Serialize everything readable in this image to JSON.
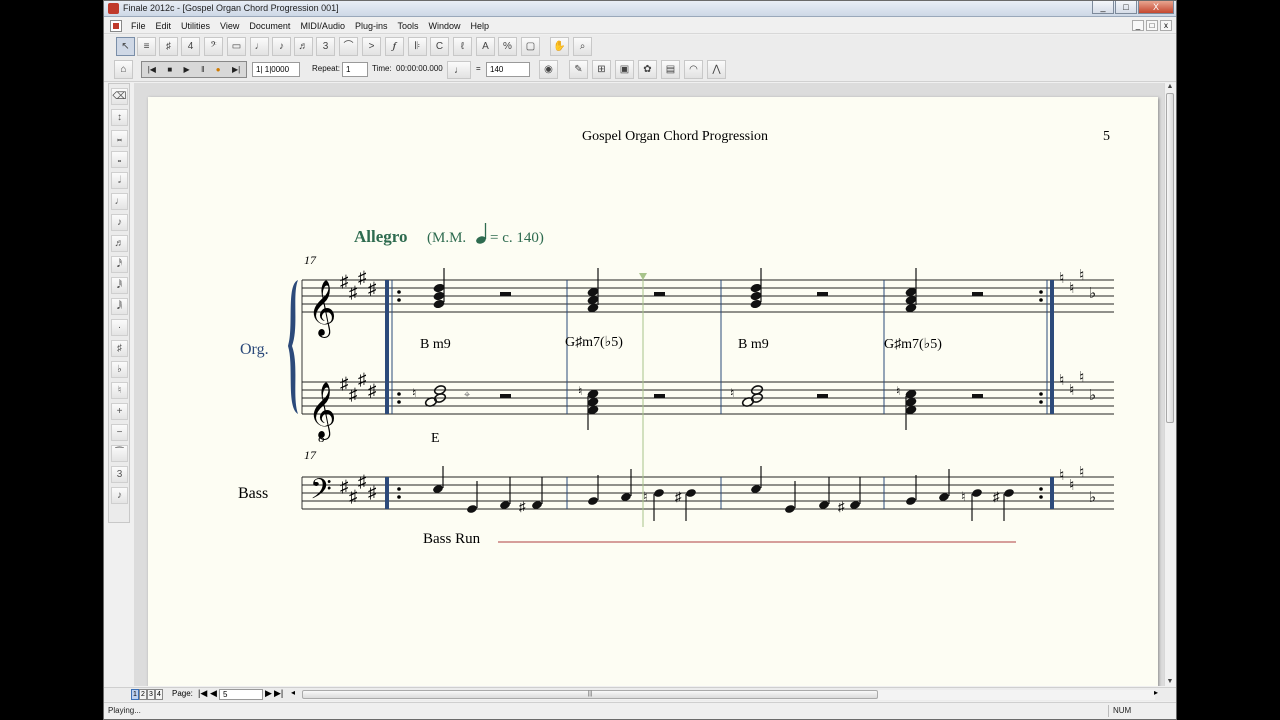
{
  "window": {
    "title": "Finale 2012c - [Gospel Organ Chord Progression 001]",
    "controls": [
      "_",
      "□",
      "X"
    ]
  },
  "menubar": {
    "items": [
      "File",
      "Edit",
      "Utilities",
      "View",
      "Document",
      "MIDI/Audio",
      "Plug-ins",
      "Tools",
      "Window",
      "Help"
    ],
    "mdi_controls": [
      "_",
      "□",
      "x"
    ]
  },
  "toolbar": {
    "tools": [
      "selection-tool-icon",
      "staff-tool-icon",
      "key-signature-icon",
      "time-signature-icon",
      "clef-icon",
      "measure-icon",
      "simple-entry-icon",
      "speedy-entry-icon",
      "hyperscribe-icon",
      "tuplet-icon",
      "smart-shape-icon",
      "articulation-icon",
      "expression-icon",
      "repeat-icon",
      "chord-icon",
      "lyrics-icon",
      "text-icon",
      "resize-icon",
      "graphics-icon",
      "hand-grabber-icon",
      "zoom-icon"
    ]
  },
  "playback": {
    "measure_display": "1| 1|0000",
    "repeat_label": "Repeat:",
    "repeat_value": "1",
    "time_label": "Time:",
    "time_value": "00:00:00.000",
    "equals": "=",
    "tempo_value": "140"
  },
  "score": {
    "page_header": "Gospel Organ Chord Progression",
    "page_number": "5",
    "tempo_marking": "Allegro",
    "metronome_prefix": "(M.M.",
    "metronome_suffix": "= c. 140)",
    "measure_number_top": "17",
    "measure_number_bass": "17",
    "instrument_organ": "Org.",
    "instrument_bass": "Bass",
    "octave_marker": "8",
    "chords": [
      "B m9",
      "G♯m7(♭5)",
      "B m9",
      "G♯m7(♭5)"
    ],
    "bass_chord": "E",
    "text_expression": "Bass  Run"
  },
  "navigation": {
    "layer_tabs": [
      "1",
      "2",
      "3",
      "4"
    ],
    "page_label": "Page:",
    "page_value": "5"
  },
  "status": {
    "text": "Playing...",
    "num_indicator": "NUM"
  },
  "colors": {
    "paper": "#fdfdf3",
    "tempo_text": "#2e6b4f",
    "instrument_text": "#2c4a7a",
    "playback_cursor": "#a8c48a",
    "text_expression_line": "#b04040"
  }
}
